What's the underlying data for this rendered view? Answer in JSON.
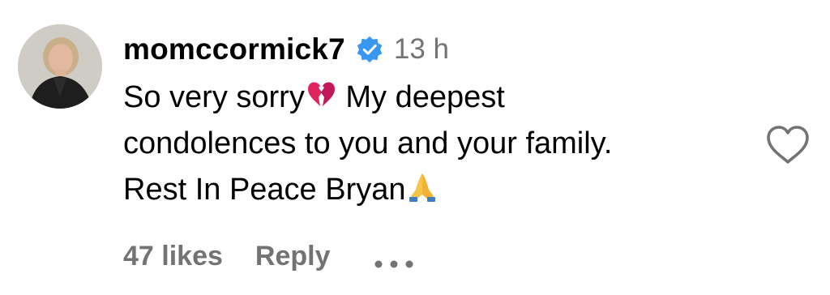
{
  "comment": {
    "username": "momccormick7",
    "verified": true,
    "time": "13 h",
    "lines": [
      {
        "text": "So very sorry",
        "emoji": "broken-heart-emoji",
        "after": " My deepest"
      },
      {
        "text": "condolences to you and your family."
      },
      {
        "text": "Rest In Peace Bryan",
        "emoji": "folded-hands-emoji"
      }
    ],
    "likes_label": "47 likes",
    "reply_label": "Reply",
    "icons": {
      "avatar": "profile-photo",
      "verified": "verified-badge-icon",
      "like": "heart-outline-icon",
      "more": "more-options-icon"
    }
  },
  "colors": {
    "text": "#000000",
    "secondary": "#737373",
    "verified_blue": "#3897F0",
    "heart_outline": "#737373",
    "broken_heart": "#E0245E",
    "folded_hands": "#F7C34A"
  }
}
